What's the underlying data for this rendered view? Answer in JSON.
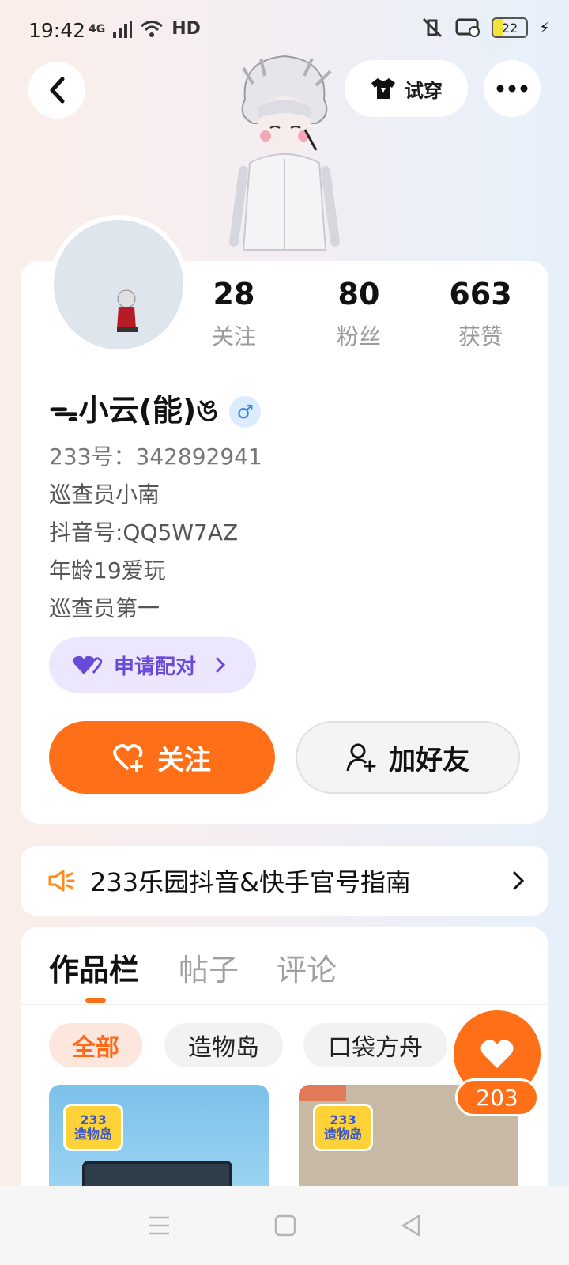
{
  "status_bar": {
    "time": "19:42",
    "network": "4G",
    "hd": "HD",
    "battery": "22"
  },
  "header": {
    "tryon_label": "试穿"
  },
  "stats": [
    {
      "value": "28",
      "label": "关注"
    },
    {
      "value": "80",
      "label": "粉丝"
    },
    {
      "value": "663",
      "label": "获赞"
    }
  ],
  "profile": {
    "nickname": "ᯓ小云(能)ঙ",
    "gender_symbol": "♂",
    "id_line": "233号：342892941",
    "bio": [
      "巡查员小南",
      "抖音号:QQ5W7AZ",
      "年龄19爱玩",
      "巡查员第一"
    ],
    "pair_label": "申请配对"
  },
  "actions": {
    "follow_label": "关注",
    "add_friend_label": "加好友"
  },
  "notice": {
    "text": "233乐园抖音&快手官号指南"
  },
  "tabs": [
    {
      "label": "作品栏",
      "active": true
    },
    {
      "label": "帖子",
      "active": false
    },
    {
      "label": "评论",
      "active": false
    }
  ],
  "filters": [
    {
      "label": "全部",
      "active": true
    },
    {
      "label": "造物岛",
      "active": false
    },
    {
      "label": "口袋方舟",
      "active": false
    }
  ],
  "works": [
    {
      "logo_num": "233",
      "logo_text": "造物岛"
    },
    {
      "logo_num": "233",
      "logo_text": "造物岛"
    }
  ],
  "like_fab": {
    "count": "203"
  },
  "colors": {
    "accent": "#ff6f17",
    "pair_bg": "#ece7ff",
    "pair_text": "#6a4ad8"
  },
  "icons": [
    "back-icon",
    "tshirt-icon",
    "more-icon",
    "heart-plus-icon",
    "user-plus-icon",
    "speaker-icon",
    "chevron-right-icon",
    "heart-icon"
  ]
}
